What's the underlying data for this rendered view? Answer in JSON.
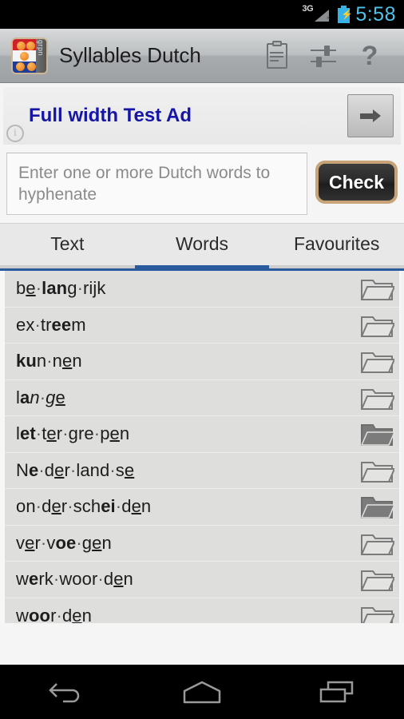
{
  "statusbar": {
    "network_label": "3G",
    "time": "5:58",
    "battery_icon": "battery-charging-icon",
    "signal_icon": "signal-3g-roaming-icon",
    "clock_color": "#4fc3e8"
  },
  "actionbar": {
    "app_icon_name": "syllables-dutch-app-icon",
    "app_icon_side_text": "grpn",
    "title": "Syllables Dutch",
    "buttons": [
      {
        "name": "paste-clipboard-button",
        "icon": "clipboard-icon"
      },
      {
        "name": "settings-button",
        "icon": "sliders-icon"
      },
      {
        "name": "help-button",
        "icon": "question-mark-icon",
        "label": "?"
      }
    ]
  },
  "ad": {
    "text": "Full width Test Ad",
    "info_label": "i",
    "go_icon": "arrow-right-icon",
    "text_color": "#1515a8"
  },
  "input": {
    "placeholder": "Enter one or more Dutch words to hyphenate",
    "value": "",
    "check_label": "Check",
    "check_border_color": "#c6a478"
  },
  "tabs": {
    "items": [
      {
        "label": "Text",
        "selected": false
      },
      {
        "label": "Words",
        "selected": true
      },
      {
        "label": "Favourites",
        "selected": false
      }
    ],
    "accent_color": "#2a5a9c"
  },
  "wordlist": {
    "rows": [
      {
        "plain": "be·lang·rijk",
        "html": "b<u>e</u><span class=\"dot\">·</span><b>lan</b>g<span class=\"dot\">·</span>rijk",
        "favourite": false
      },
      {
        "plain": "ex·treem",
        "html": "ex<span class=\"dot\">·</span>tr<b>ee</b>m",
        "favourite": false
      },
      {
        "plain": "kun·nen",
        "html": "<b>ku</b>n<span class=\"dot\">·</span>n<u>e</u>n",
        "favourite": false
      },
      {
        "plain": "lan·ge",
        "html": "l<b>a</b><i>n</i><span class=\"dot\">·</span><i>g</i><u>e</u>",
        "favourite": false
      },
      {
        "plain": "let·ter·gre·pen",
        "html": "l<b>et</b><span class=\"dot\">·</span>t<u>e</u>r<span class=\"dot\">·</span>gre<span class=\"dot\">·</span>p<u>e</u>n",
        "favourite": true
      },
      {
        "plain": "Ne·der·land·se",
        "html": "N<b>e</b><span class=\"dot\">·</span>d<u>e</u>r<span class=\"dot\">·</span>land<span class=\"dot\">·</span>s<u>e</u>",
        "favourite": false
      },
      {
        "plain": "on·der·schei·den",
        "html": "on<span class=\"dot\">·</span>d<u>e</u>r<span class=\"dot\">·</span>sch<b>ei</b><span class=\"dot\">·</span>d<u>e</u>n",
        "favourite": true
      },
      {
        "plain": "ver·voe·gen",
        "html": "v<u>e</u>r<span class=\"dot\">·</span>v<b>oe</b><span class=\"dot\">·</span>g<u>e</u>n",
        "favourite": false
      },
      {
        "plain": "werk·woor·den",
        "html": "w<b>e</b>rk<span class=\"dot\">·</span>woor<span class=\"dot\">·</span>d<u>e</u>n",
        "favourite": false
      },
      {
        "plain": "woor·den",
        "html": "w<b>oo</b>r<span class=\"dot\">·</span>d<u>e</u>n",
        "favourite": false
      }
    ]
  },
  "navbar": {
    "buttons": [
      {
        "name": "nav-back-button",
        "icon": "back-arrow-icon"
      },
      {
        "name": "nav-home-button",
        "icon": "home-icon"
      },
      {
        "name": "nav-recents-button",
        "icon": "recents-icon"
      }
    ]
  }
}
